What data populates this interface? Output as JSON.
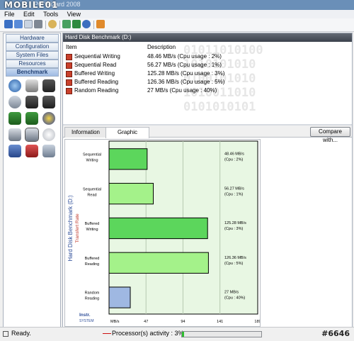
{
  "window": {
    "title": "PC Wizard 2008",
    "logo_text": "MOBILE01"
  },
  "menu": [
    "File",
    "Edit",
    "Tools",
    "View"
  ],
  "toolbar": {
    "icons": [
      "save-icon",
      "save-all-icon",
      "copy-icon",
      "print-icon",
      "search-icon",
      "hardware-icon",
      "refresh-icon",
      "help-icon",
      "home-icon"
    ]
  },
  "nav": {
    "buttons": [
      "Hardware",
      "Configuration",
      "System Files",
      "Resources",
      "Benchmark"
    ],
    "active": "Benchmark"
  },
  "benchmark_icons": [
    "cpu-benchmark-icon",
    "drive-benchmark-icon",
    "disk-write-icon",
    "cache-icon",
    "l1-cache-icon",
    "l2-cache-icon",
    "ram-icon",
    "memory-icon",
    "video-icon",
    "hard-disk-icon",
    "hard-disk-selected-icon",
    "cdrom-icon",
    "network-icon",
    "mp3-icon",
    "compression-icon"
  ],
  "panel": {
    "title": "Hard Disk Benchmark (D:)",
    "col_item": "Item",
    "col_desc": "Description"
  },
  "items": [
    {
      "name": "Sequential Writing",
      "desc": "48.46 MB/s  (Cpu usage : 2%)"
    },
    {
      "name": "Sequential Read",
      "desc": "56.27 MB/s  (Cpu usage : 1%)"
    },
    {
      "name": "Buffered Writing",
      "desc": "125.28 MB/s  (Cpu usage : 3%)"
    },
    {
      "name": "Buffered Reading",
      "desc": "126.36 MB/s  (Cpu usage : 5%)"
    },
    {
      "name": "Random Reading",
      "desc": "27 MB/s  (Cpu usage : 40%)"
    }
  ],
  "tabs": [
    "Information",
    "Graphic"
  ],
  "active_tab": "Graphic",
  "compare_label": "Compare with...",
  "chart_data": {
    "type": "bar",
    "orientation": "horizontal",
    "title": "Hard Disk Benchmark (D:)",
    "ylabel": "Transfert Rate",
    "categories": [
      "Sequential Writing",
      "Sequential Read",
      "Buffered Writing",
      "Buffered Reading",
      "Random Reading"
    ],
    "values": [
      48.46,
      56.27,
      125.28,
      126.36,
      27
    ],
    "value_labels": [
      [
        "48.46   MB/s",
        "(Cpu : 2%)"
      ],
      [
        "56.27   MB/s",
        "(Cpu : 1%)"
      ],
      [
        "125.28   MB/s",
        "(Cpu : 3%)"
      ],
      [
        "126.36   MB/s",
        "(Cpu : 5%)"
      ],
      [
        "27   MB/s",
        "(Cpu : 40%)"
      ]
    ],
    "bar_colors": [
      "#5cd65c",
      "#a4f28a",
      "#5cd65c",
      "#a4f28a",
      "#9fb8e2"
    ],
    "xlim": [
      0,
      189
    ],
    "xticks": [
      "MB/s",
      "47",
      "94",
      "141",
      "189"
    ],
    "grid": true,
    "brand": [
      "Instr.",
      "SYSTEM"
    ]
  },
  "status": {
    "ready": "Ready.",
    "processor": "Processor(s) activity : 3%",
    "activity_percent": 3,
    "watermark": "#6646"
  },
  "colors": {
    "accent": "#2f4f9a",
    "bar_green": "#5cd65c",
    "bar_light": "#a4f28a",
    "bar_blue": "#9fb8e2"
  }
}
